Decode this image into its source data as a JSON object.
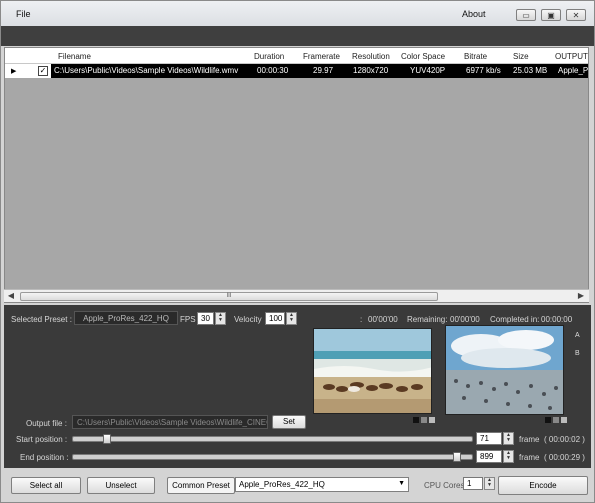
{
  "menu": {
    "file": "File",
    "about": "About"
  },
  "window_controls": {
    "minimize": "▭",
    "maximize": "▣",
    "close": "✕"
  },
  "table": {
    "columns": [
      "Filename",
      "Duration",
      "Framerate",
      "Resolution",
      "Color Space",
      "Bitrate",
      "Size",
      "OUTPUT"
    ],
    "rows": [
      {
        "checked": "✓",
        "filename": "C:\\Users\\Public\\Videos\\Sample Videos\\Wildlife.wmv",
        "duration": "00:00:30",
        "framerate": "29.97",
        "resolution": "1280x720",
        "color_space": "YUV420P",
        "bitrate": "6977 kb/s",
        "size": "25.03 MB",
        "output": "Apple_P..."
      }
    ]
  },
  "scroll": {
    "grip": "III",
    "left_arrow": "◀",
    "right_arrow": "▶"
  },
  "preset_bar": {
    "selected_preset_label": "Selected Preset :",
    "selected_preset_value": "Apple_ProRes_422_HQ",
    "fps_label": "FPS",
    "fps_value": "30",
    "velocity_label": "Velocity",
    "velocity_value": "100",
    "time_sep": ":",
    "time_value": "00'00'00",
    "remaining_label": "Remaining:",
    "remaining_value": "00'00'00",
    "completed_label": "Completed in:",
    "completed_value": "00:00:00"
  },
  "side_labels": {
    "a": "A",
    "b": "B"
  },
  "output": {
    "label": "Output file :",
    "value": "C:\\Users\\Public\\Videos\\Sample Videos\\Wildlife_CINEC",
    "set_label": "Set"
  },
  "start": {
    "label": "Start position :",
    "value": "71",
    "unit": "frame",
    "time": "( 00:00:02 )",
    "fraction": 0.08
  },
  "end": {
    "label": "End position :",
    "value": "899",
    "unit": "frame",
    "time": "( 00:00:29 )",
    "fraction": 0.97
  },
  "footer": {
    "select_all": "Select all",
    "unselect": "Unselect",
    "common_preset": "Common Preset",
    "preset_value": "Apple_ProRes_422_HQ",
    "cpu_label": "CPU Cores",
    "cpu_value": "1",
    "encode": "Encode"
  },
  "colors": {
    "panel_bg": "#3a3a3a",
    "selection": "#000000",
    "table_bg": "#a7a7a7"
  }
}
